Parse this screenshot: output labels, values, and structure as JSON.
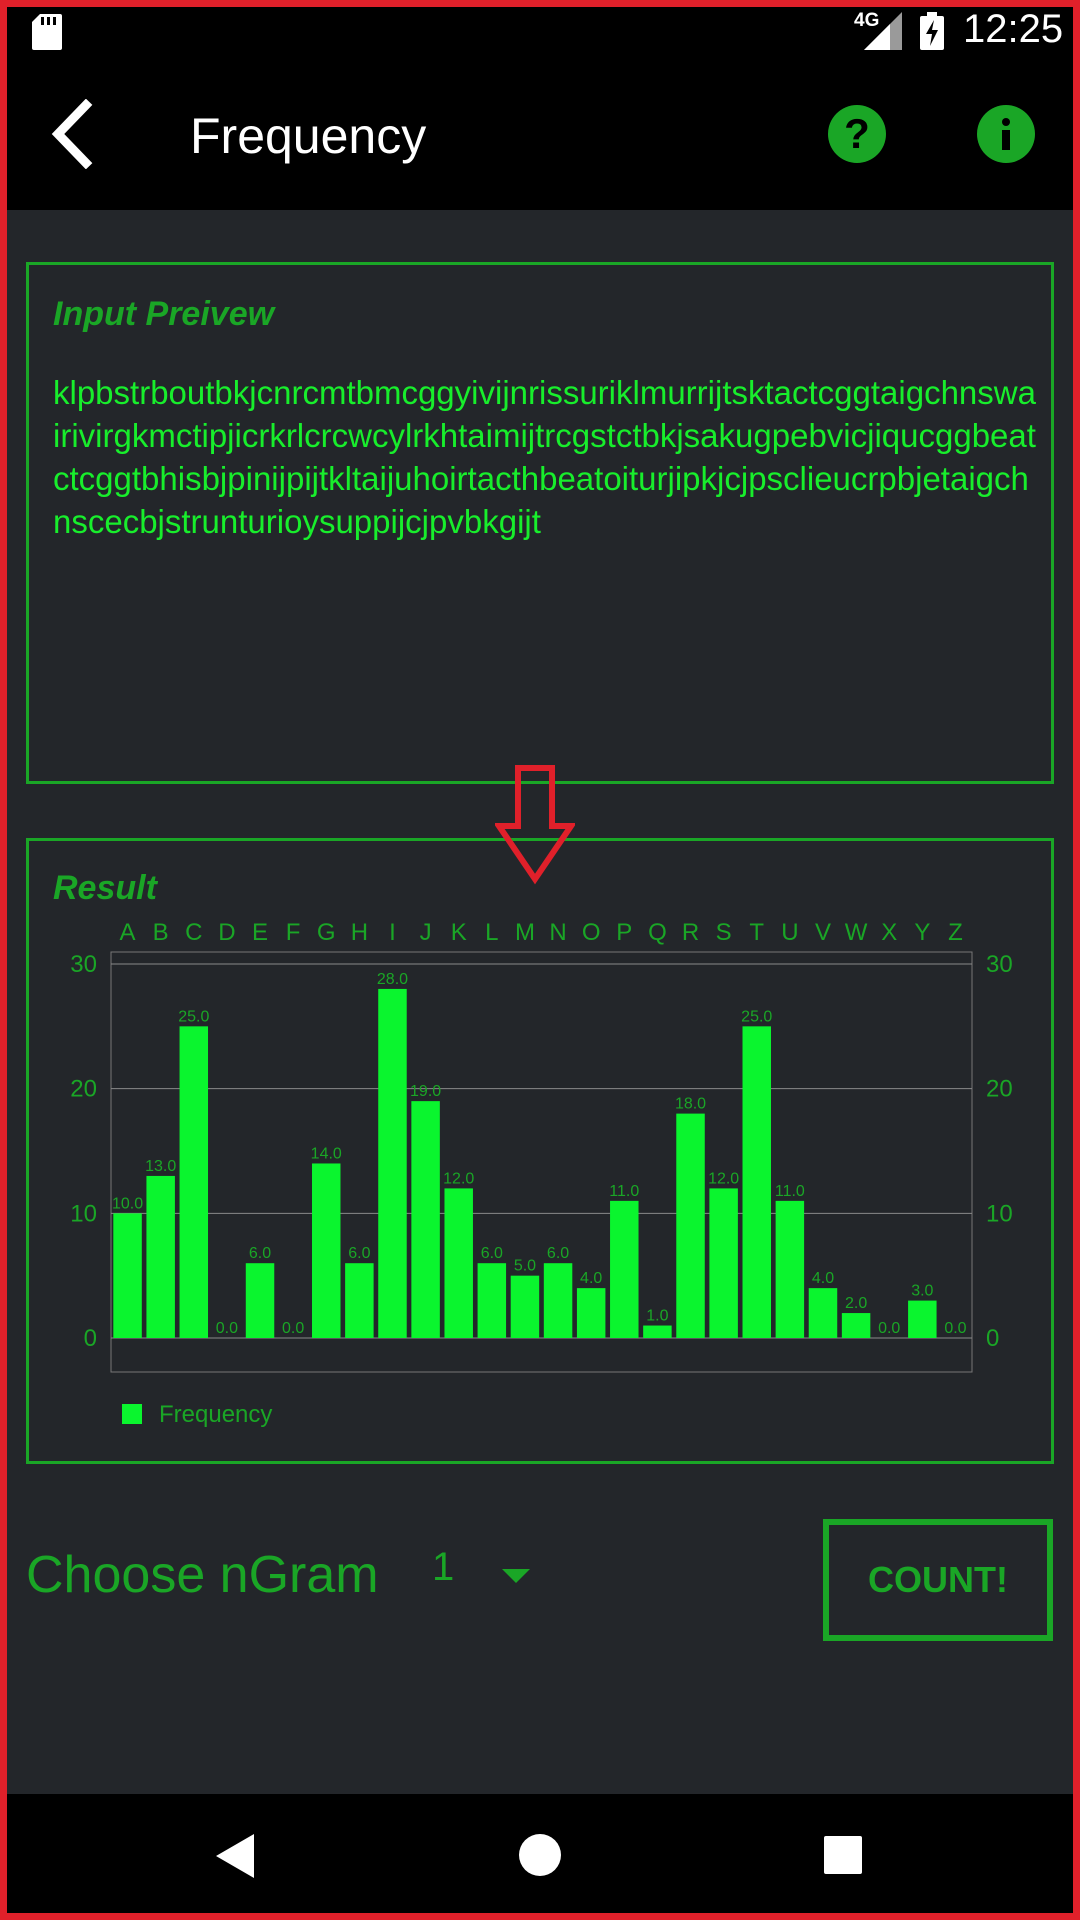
{
  "status_bar": {
    "network": "4G",
    "time": "12:25",
    "icons": [
      "sd-card-icon",
      "signal-icon",
      "battery-charging-icon"
    ]
  },
  "app_bar": {
    "title": "Frequency",
    "icons": [
      "back-icon",
      "help-icon",
      "info-icon"
    ],
    "help_glyph": "?"
  },
  "input_preview": {
    "label": "Input Preivew",
    "text": "klpbstrboutbkjcnrcmtbmcggyivijnrissuriklmurrijtsktactcggtaigchnswairivirgkmctipjicrkrlcrcwcylrkhtaimijtrcgstctbkjsakugpebvicjiqucggbeatctcggtbhisbjpinijpijtkltaijuhoirtacthbeatoiturjipkjcjpsclieucrpbjetaigchnscecbjstrunturioysuppijcjpvbkgijt"
  },
  "result": {
    "label": "Result"
  },
  "chart_data": {
    "type": "bar",
    "categories": [
      "A",
      "B",
      "C",
      "D",
      "E",
      "F",
      "G",
      "H",
      "I",
      "J",
      "K",
      "L",
      "M",
      "N",
      "O",
      "P",
      "Q",
      "R",
      "S",
      "T",
      "U",
      "V",
      "W",
      "X",
      "Y",
      "Z"
    ],
    "series": [
      {
        "name": "Frequency",
        "values": [
          10,
          13,
          25,
          0,
          6,
          0,
          14,
          6,
          28,
          19,
          12,
          6,
          5,
          6,
          4,
          11,
          1,
          18,
          12,
          25,
          11,
          4,
          2,
          0,
          3,
          0
        ]
      }
    ],
    "value_labels": [
      "10.0",
      "13.0",
      "25.0",
      "0.0",
      "6.0",
      "0.0",
      "14.0",
      "6.0",
      "28.0",
      "19.0",
      "12.0",
      "6.0",
      "5.0",
      "6.0",
      "4.0",
      "11.0",
      "1.0",
      "18.0",
      "12.0",
      "25.0",
      "11.0",
      "4.0",
      "2.0",
      "0.0",
      "3.0",
      "0.0"
    ],
    "ylim": [
      0,
      30
    ],
    "yticks": [
      "0",
      "10",
      "20",
      "30"
    ],
    "grid": true,
    "legend": "bottom-left",
    "bar_color": "#0af52e",
    "label_color": "#1aa626"
  },
  "controls": {
    "ngram_label": "Choose nGram",
    "ngram_value": "1",
    "count_label": "COUNT!"
  },
  "colors": {
    "accent": "#1aa626",
    "text_bright": "#18ee2c",
    "background": "#23262a",
    "frame": "#e0202a"
  }
}
